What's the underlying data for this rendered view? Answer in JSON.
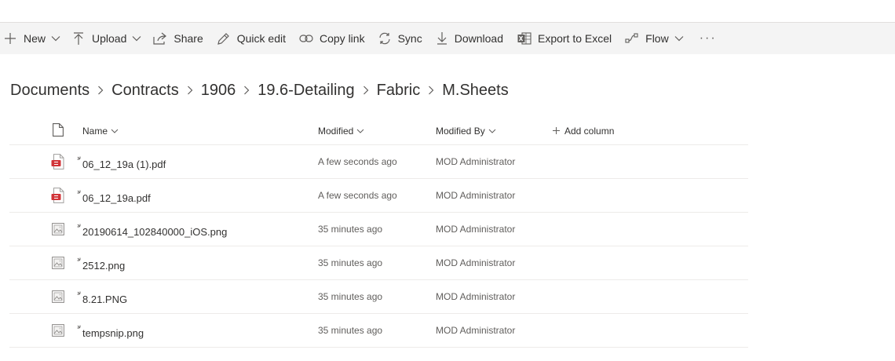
{
  "commandbar": {
    "new_label": "New",
    "upload_label": "Upload",
    "share_label": "Share",
    "quick_edit_label": "Quick edit",
    "copy_link_label": "Copy link",
    "sync_label": "Sync",
    "download_label": "Download",
    "export_label": "Export to Excel",
    "flow_label": "Flow",
    "more_label": "···"
  },
  "breadcrumb": {
    "items": [
      "Documents",
      "Contracts",
      "1906",
      "19.6-Detailing",
      "Fabric",
      "M.Sheets"
    ]
  },
  "list": {
    "columns": {
      "name": "Name",
      "modified": "Modified",
      "modified_by": "Modified By",
      "add_column": "Add column"
    },
    "rows": [
      {
        "name": "06_12_19a (1).pdf",
        "modified": "A few seconds ago",
        "modified_by": "MOD Administrator",
        "type": "pdf"
      },
      {
        "name": "06_12_19a.pdf",
        "modified": "A few seconds ago",
        "modified_by": "MOD Administrator",
        "type": "pdf"
      },
      {
        "name": "20190614_102840000_iOS.png",
        "modified": "35 minutes ago",
        "modified_by": "MOD Administrator",
        "type": "image"
      },
      {
        "name": "2512.png",
        "modified": "35 minutes ago",
        "modified_by": "MOD Administrator",
        "type": "image"
      },
      {
        "name": "8.21.PNG",
        "modified": "35 minutes ago",
        "modified_by": "MOD Administrator",
        "type": "image"
      },
      {
        "name": "tempsnip.png",
        "modified": "35 minutes ago",
        "modified_by": "MOD Administrator",
        "type": "image"
      }
    ]
  },
  "colors": {
    "commandbar_bg": "#f4f4f4",
    "pdf_red": "#d13438",
    "text": "#323130",
    "subtle": "#605e5c"
  }
}
